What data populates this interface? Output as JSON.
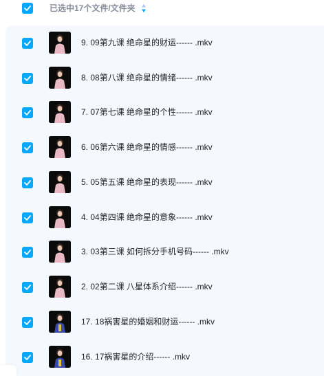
{
  "header": {
    "selection_label": "已选中17个文件/文件夹",
    "select_all_checked": true,
    "sort_icon": "sort-updown-icon"
  },
  "colors": {
    "accent": "#06a7ff",
    "list_background": "#f5f9ff",
    "header_text": "#878c9c",
    "row_text": "#1f2329"
  },
  "files": [
    {
      "name": "9. 09第九课 绝命星的财运------ .mkv",
      "checked": true,
      "thumb": "video-thumbnail-pink"
    },
    {
      "name": "8. 08第八课 绝命星的情绪------ .mkv",
      "checked": true,
      "thumb": "video-thumbnail-pink"
    },
    {
      "name": "7. 07第七课 绝命星的个性------ .mkv",
      "checked": true,
      "thumb": "video-thumbnail-pink"
    },
    {
      "name": "6. 06第六课 绝命星的情感------ .mkv",
      "checked": true,
      "thumb": "video-thumbnail-pink"
    },
    {
      "name": "5. 05第五课 绝命星的表现------ .mkv",
      "checked": true,
      "thumb": "video-thumbnail-pink"
    },
    {
      "name": "4. 04第四课 绝命星的意象------ .mkv",
      "checked": true,
      "thumb": "video-thumbnail-pink"
    },
    {
      "name": "3. 03第三课 如何拆分手机号码------ .mkv",
      "checked": true,
      "thumb": "video-thumbnail-pink"
    },
    {
      "name": "2. 02第二课 八星体系介绍------ .mkv",
      "checked": true,
      "thumb": "video-thumbnail-pink"
    },
    {
      "name": "17. 18祸害星的婚姻和财运------ .mkv",
      "checked": true,
      "thumb": "video-thumbnail-blue"
    },
    {
      "name": "16. 17祸害星的介绍------ .mkv",
      "checked": true,
      "thumb": "video-thumbnail-blue"
    }
  ]
}
